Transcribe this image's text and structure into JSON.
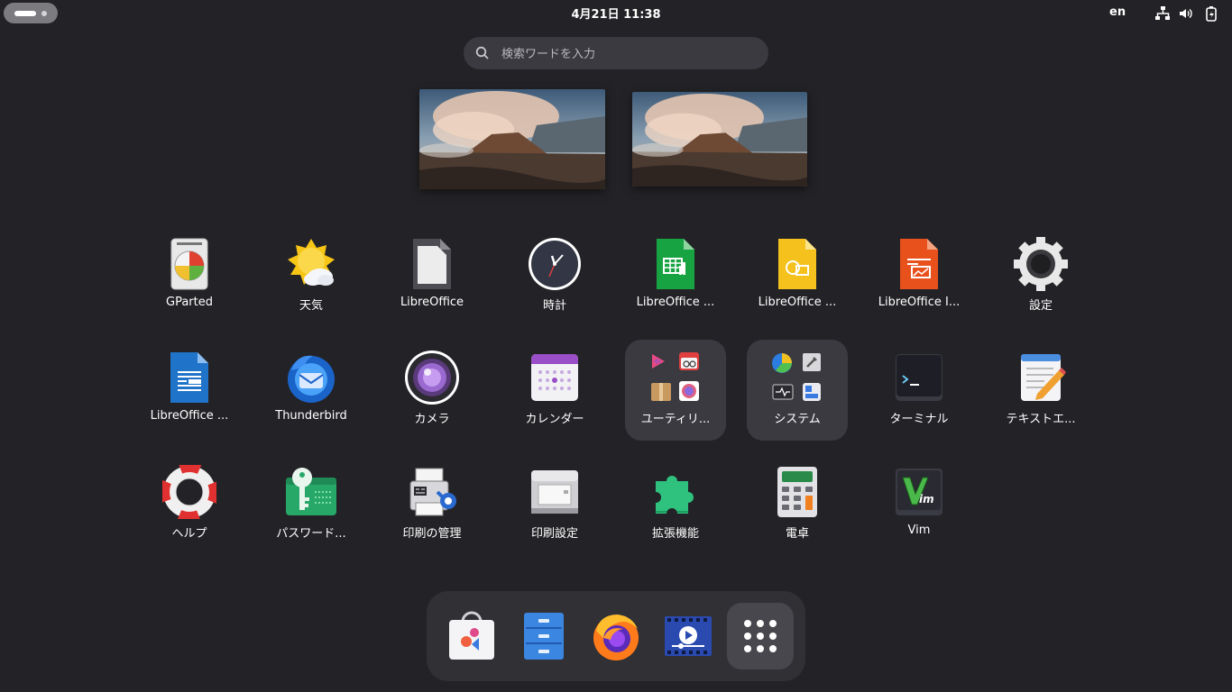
{
  "topbar": {
    "clock": "4月21日  11:38",
    "keyboard_layout": "en"
  },
  "search": {
    "placeholder": "検索ワードを入力"
  },
  "apps": [
    {
      "label": "GParted",
      "icon": "gparted-icon"
    },
    {
      "label": "天気",
      "icon": "weather-icon"
    },
    {
      "label": "LibreOffice",
      "icon": "libreoffice-icon"
    },
    {
      "label": "時計",
      "icon": "clock-icon"
    },
    {
      "label": "LibreOffice ...",
      "icon": "libreoffice-calc-icon"
    },
    {
      "label": "LibreOffice ...",
      "icon": "libreoffice-draw-icon"
    },
    {
      "label": "LibreOffice I...",
      "icon": "libreoffice-impress-icon"
    },
    {
      "label": "設定",
      "icon": "settings-gear-icon"
    },
    {
      "label": "LibreOffice ...",
      "icon": "libreoffice-writer-icon"
    },
    {
      "label": "Thunderbird",
      "icon": "thunderbird-icon"
    },
    {
      "label": "カメラ",
      "icon": "camera-icon"
    },
    {
      "label": "カレンダー",
      "icon": "calendar-icon"
    },
    {
      "label": "ユーティリ...",
      "icon": "utilities-folder-icon"
    },
    {
      "label": "システム",
      "icon": "system-folder-icon"
    },
    {
      "label": "ターミナル",
      "icon": "terminal-icon"
    },
    {
      "label": "テキストエ...",
      "icon": "text-editor-icon"
    },
    {
      "label": "ヘルプ",
      "icon": "help-lifebuoy-icon"
    },
    {
      "label": "パスワード...",
      "icon": "passwords-keys-icon"
    },
    {
      "label": "印刷の管理",
      "icon": "print-manager-icon"
    },
    {
      "label": "印刷設定",
      "icon": "printer-settings-icon"
    },
    {
      "label": "拡張機能",
      "icon": "extensions-puzzle-icon"
    },
    {
      "label": "電卓",
      "icon": "calculator-icon"
    },
    {
      "label": "Vim",
      "icon": "vim-icon"
    }
  ],
  "dock": [
    {
      "name": "software-store",
      "icon": "software-bag-icon"
    },
    {
      "name": "files",
      "icon": "file-cabinet-icon"
    },
    {
      "name": "firefox",
      "icon": "firefox-icon"
    },
    {
      "name": "video-player",
      "icon": "video-player-icon"
    },
    {
      "name": "show-apps",
      "icon": "app-grid-icon"
    }
  ],
  "colors": {
    "background": "#232327",
    "search_bg": "#3a3a40",
    "dock_bg": "#303035",
    "folder_bg": "#3a3a40"
  }
}
